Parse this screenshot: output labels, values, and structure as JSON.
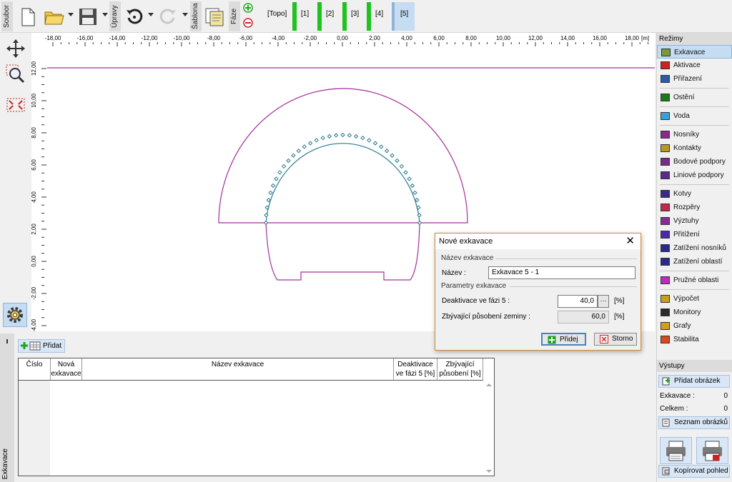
{
  "toolbar": {
    "file_label": "Soubor",
    "edit_label": "Úpravy",
    "template_label": "Šablona",
    "phases_label": "Fáze",
    "phases": [
      "[Topo]",
      "[1]",
      "[2]",
      "[3]",
      "[4]",
      "[5]"
    ],
    "active_phase": "[5]"
  },
  "canvas": {
    "unit": "[m]",
    "x_ticks": [
      "-18,00",
      "-16,00",
      "-14,00",
      "-12,00",
      "-10,00",
      "-8,00",
      "-6,00",
      "-4,00",
      "-2,00",
      "0,00",
      "2,00",
      "4,00",
      "6,00",
      "8,00",
      "10,00",
      "12,00",
      "14,00",
      "16,00",
      "18,00"
    ],
    "y_ticks": [
      "12,00",
      "10,00",
      "8,00",
      "6,00",
      "4,00",
      "2,00",
      "0,00",
      "-2,00",
      "-4,00"
    ],
    "colors": {
      "boundary": "#a0309a",
      "excavation": "#2a7a8c"
    }
  },
  "right_panel": {
    "modes_header": "Režimy",
    "groups": [
      [
        {
          "label": "Exkavace",
          "icon": "excavation-icon",
          "selected": true
        },
        {
          "label": "Aktivace",
          "icon": "activation-icon"
        },
        {
          "label": "Přiřazení",
          "icon": "assignment-icon"
        }
      ],
      [
        {
          "label": "Ostění",
          "icon": "lining-icon"
        }
      ],
      [
        {
          "label": "Voda",
          "icon": "water-icon"
        }
      ],
      [
        {
          "label": "Nosníky",
          "icon": "beams-icon"
        },
        {
          "label": "Kontakty",
          "icon": "contacts-icon"
        },
        {
          "label": "Bodové podpory",
          "icon": "point-supports-icon"
        },
        {
          "label": "Liniové podpory",
          "icon": "line-supports-icon"
        }
      ],
      [
        {
          "label": "Kotvy",
          "icon": "anchors-icon"
        },
        {
          "label": "Rozpěry",
          "icon": "props-icon"
        },
        {
          "label": "Výztuhy",
          "icon": "reinforcements-icon"
        },
        {
          "label": "Přitížení",
          "icon": "surcharge-icon"
        },
        {
          "label": "Zatížení nosníků",
          "icon": "beam-loads-icon"
        },
        {
          "label": "Zatížení oblastí",
          "icon": "region-loads-icon"
        }
      ],
      [
        {
          "label": "Pružné oblasti",
          "icon": "elastic-regions-icon"
        }
      ],
      [
        {
          "label": "Výpočet",
          "icon": "analysis-icon"
        },
        {
          "label": "Monitory",
          "icon": "monitors-icon"
        },
        {
          "label": "Grafy",
          "icon": "graphs-icon"
        },
        {
          "label": "Stabilita",
          "icon": "stability-icon"
        }
      ]
    ],
    "outputs_header": "Výstupy",
    "add_picture": "Přidat obrázek",
    "excavation_label": "Exkavace :",
    "excavation_count": "0",
    "total_label": "Celkem :",
    "total_count": "0",
    "picture_list": "Seznam obrázků",
    "copy_view": "Kopírovat pohled"
  },
  "bottom": {
    "side_label": "Exkavace",
    "add_button": "Přidat",
    "columns": {
      "number": "Číslo",
      "new_l1": "Nová",
      "new_l2": "exkavace",
      "name": "Název exkavace",
      "deact_l1": "Deaktivace",
      "deact_l2": "ve fázi 5 [%]",
      "remain_l1": "Zbývající",
      "remain_l2": "působení [%]"
    }
  },
  "dialog": {
    "title": "Nové exkavace",
    "group_name": "Název exkavace",
    "name_label": "Název :",
    "name_value": "Exkavace 5 - 1",
    "group_params": "Parametry exkavace",
    "deact_label": "Deaktivace ve fázi 5 :",
    "deact_value": "40,0",
    "remain_label": "Zbývající působení zeminy :",
    "remain_value": "60,0",
    "unit": "[%]",
    "add_button": "Přidej",
    "cancel_button": "Storno"
  }
}
